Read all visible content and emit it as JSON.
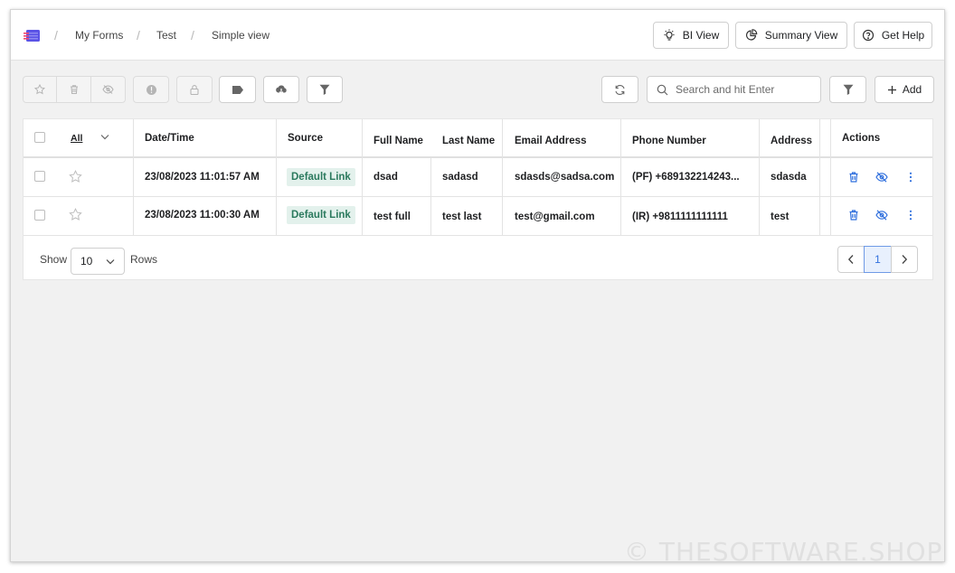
{
  "breadcrumb": {
    "items": [
      "My Forms",
      "Test",
      "Simple view"
    ]
  },
  "header_buttons": {
    "bi_view": "BI View",
    "summary_view": "Summary View",
    "get_help": "Get Help"
  },
  "search": {
    "placeholder": "Search and hit Enter"
  },
  "add_button": "Add",
  "table": {
    "all_label": "All",
    "columns": [
      "Date/Time",
      "Source",
      "Full Name",
      "Last Name",
      "Email Address",
      "Phone Number",
      "Address",
      "Actions"
    ],
    "rows": [
      {
        "datetime": "23/08/2023 11:01:57 AM",
        "source": "Default Link",
        "full_name": "dsad",
        "last_name": "sadasd",
        "email": "sdasds@sadsa.com",
        "phone": "(PF) +689132214243...",
        "address": "sdasda"
      },
      {
        "datetime": "23/08/2023 11:00:30 AM",
        "source": "Default Link",
        "full_name": "test full",
        "last_name": "test last",
        "email": "test@gmail.com",
        "phone": "(IR) +9811111111111",
        "address": "test"
      }
    ]
  },
  "footer": {
    "show_label": "Show",
    "rows_value": "10",
    "rows_label": "Rows",
    "current_page": "1"
  },
  "watermark": "© THESOFTWARE.SHOP",
  "colors": {
    "accent": "#2f6fdd",
    "badge_bg": "#e3f1ec",
    "badge_text": "#2b7a5e",
    "page_bg": "#f1f1f1"
  }
}
